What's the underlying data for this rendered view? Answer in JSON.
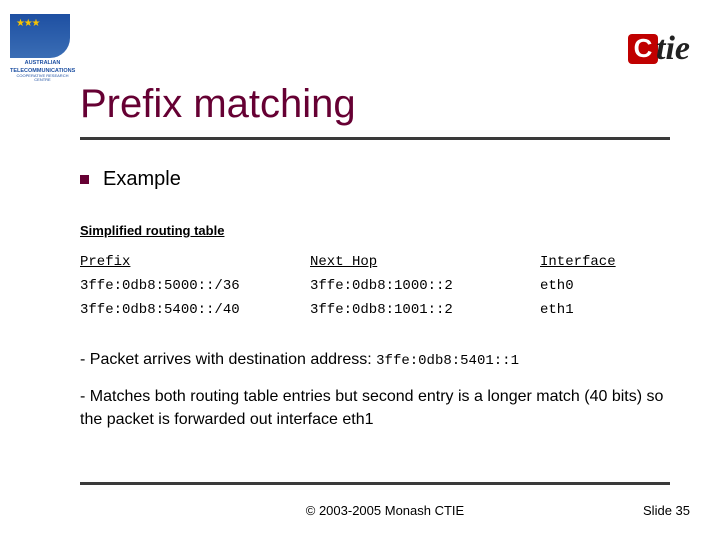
{
  "logoLeft": {
    "line1": "AUSTRALIAN",
    "line2": "TELECOMMUNICATIONS",
    "line3": "COOPERATIVE RESEARCH CENTRE"
  },
  "logoRight": {
    "c": "C",
    "rest": "tie"
  },
  "title": "Prefix matching",
  "exampleLabel": "Example",
  "tableCaption": "Simplified routing table",
  "tableHeader": {
    "c1": "Prefix",
    "c2": "Next Hop",
    "c3": "Interface"
  },
  "rows": [
    {
      "c1": "3ffe:0db8:5000::/36",
      "c2": "3ffe:0db8:1000::2",
      "c3": "eth0"
    },
    {
      "c1": "3ffe:0db8:5400::/40",
      "c2": "3ffe:0db8:1001::2",
      "c3": "eth1"
    }
  ],
  "para1a": "- Packet arrives with destination address: ",
  "para1addr": "3ffe:0db8:5401::1",
  "para2": "- Matches both routing table entries but second entry is a longer match (40 bits) so the packet is forwarded out interface eth1",
  "copyright": "© 2003-2005 Monash CTIE",
  "slide": "Slide 35"
}
